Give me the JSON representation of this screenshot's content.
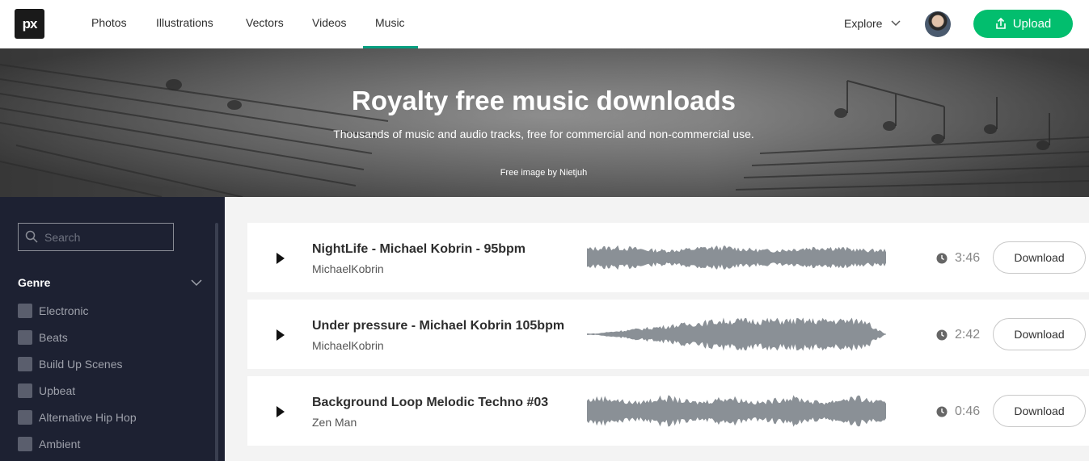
{
  "header": {
    "logo": "px",
    "nav": [
      "Photos",
      "Illustrations",
      "Vectors",
      "Videos",
      "Music"
    ],
    "active_nav": "Music",
    "explore": "Explore",
    "upload": "Upload"
  },
  "hero": {
    "title": "Royalty free music downloads",
    "subtitle": "Thousands of music and audio tracks, free for commercial and non-commercial use.",
    "credit": "Free image by Nietjuh"
  },
  "sidebar": {
    "search_placeholder": "Search",
    "genre_title": "Genre",
    "genres": [
      "Electronic",
      "Beats",
      "Build Up Scenes",
      "Upbeat",
      "Alternative Hip Hop",
      "Ambient"
    ]
  },
  "tracks": [
    {
      "title": "NightLife - Michael Kobrin - 95bpm",
      "artist": "MichaelKobrin",
      "duration": "3:46",
      "download": "Download"
    },
    {
      "title": "Under pressure - Michael Kobrin 105bpm",
      "artist": "MichaelKobrin",
      "duration": "2:42",
      "download": "Download"
    },
    {
      "title": "Background Loop Melodic Techno #03",
      "artist": "Zen Man",
      "duration": "0:46",
      "download": "Download"
    }
  ],
  "colors": {
    "accent": "#02be6e",
    "sidebar_bg": "#1d2132",
    "waveform": "#8a9096"
  }
}
